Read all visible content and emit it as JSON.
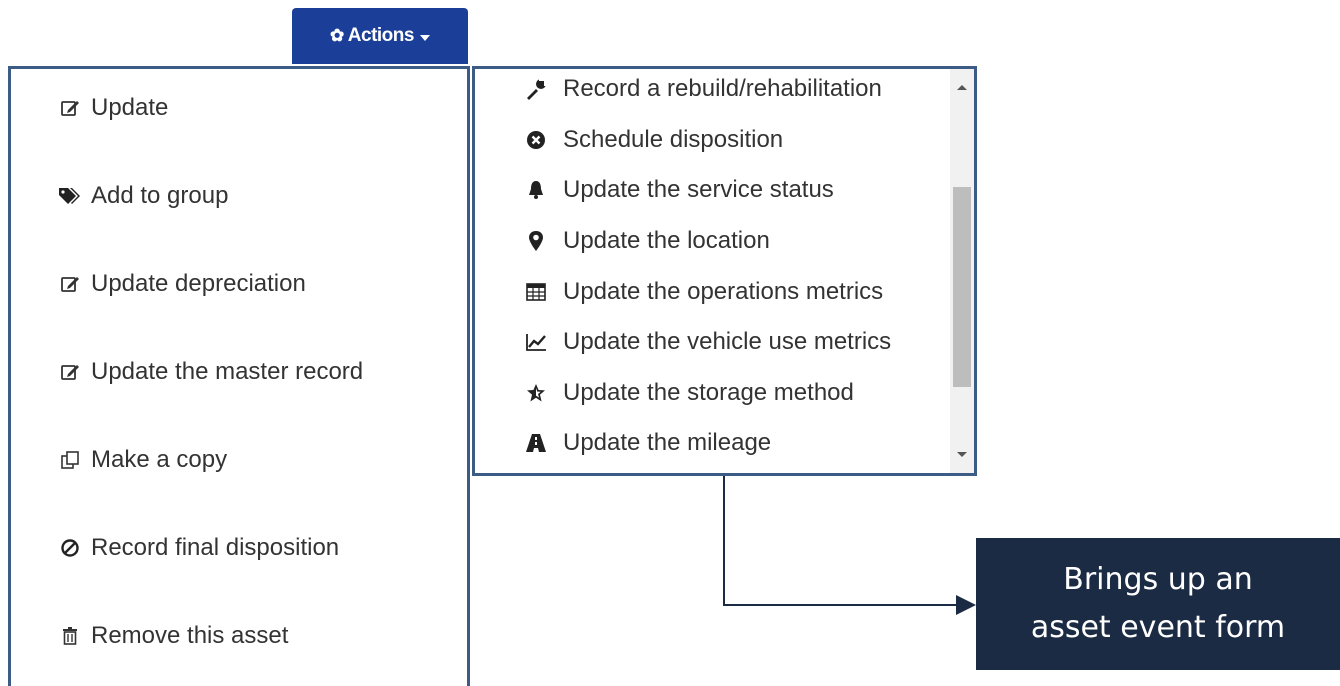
{
  "actions_button": {
    "label": "Actions"
  },
  "left_menu": {
    "items": [
      {
        "label": "Update",
        "icon": "edit-icon"
      },
      {
        "label": "Add to group",
        "icon": "tags-icon"
      },
      {
        "label": "Update depreciation",
        "icon": "edit-icon"
      },
      {
        "label": "Update the master record",
        "icon": "edit-icon"
      },
      {
        "label": "Make a copy",
        "icon": "copy-icon"
      },
      {
        "label": "Record final disposition",
        "icon": "ban-icon"
      },
      {
        "label": "Remove this asset",
        "icon": "trash-icon"
      }
    ]
  },
  "sub_menu": {
    "items": [
      {
        "label": "Record a rebuild/rehabilitation",
        "icon": "wrench-icon"
      },
      {
        "label": "Schedule disposition",
        "icon": "remove-circle-icon"
      },
      {
        "label": "Update the service status",
        "icon": "bell-icon"
      },
      {
        "label": "Update the location",
        "icon": "map-marker-icon"
      },
      {
        "label": "Update the operations metrics",
        "icon": "calculator-icon"
      },
      {
        "label": "Update the vehicle use metrics",
        "icon": "line-chart-icon"
      },
      {
        "label": "Update the storage method",
        "icon": "star-icon"
      },
      {
        "label": "Update the mileage",
        "icon": "road-icon"
      }
    ]
  },
  "callout": {
    "line1": "Brings up an",
    "line2": "asset event form"
  },
  "colors": {
    "button_bg": "#1b3f98",
    "border": "#3c5b85",
    "callout_bg": "#1c2b44"
  }
}
